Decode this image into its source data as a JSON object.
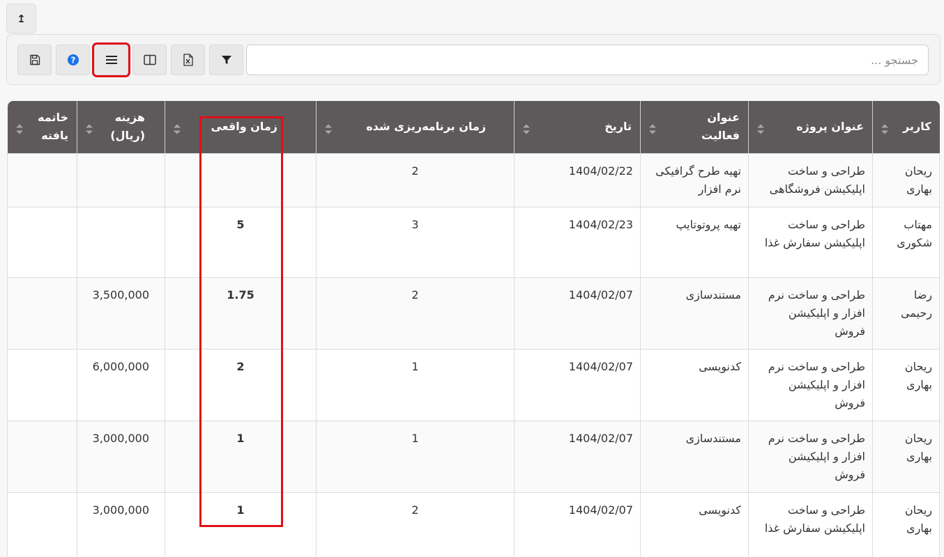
{
  "top": {
    "back_icon": "arrow-up-left-icon",
    "back_glyph": "↥"
  },
  "toolbar": {
    "search_placeholder": "جستجو ...",
    "buttons": [
      {
        "name": "save-button",
        "icon": "save-icon"
      },
      {
        "name": "help-button",
        "icon": "help-icon",
        "color": "#1a73e8"
      },
      {
        "name": "menu-button",
        "icon": "hamburger-icon"
      },
      {
        "name": "columns-button",
        "icon": "columns-icon"
      },
      {
        "name": "excel-export-button",
        "icon": "excel-icon"
      },
      {
        "name": "filter-button",
        "icon": "filter-icon"
      }
    ]
  },
  "table": {
    "headers": {
      "user": "کاربر",
      "project": "عنوان پروژه",
      "activity": "عنوان\nفعالیت",
      "date": "تاریخ",
      "planned": "زمان برنامه‌ریزی شده",
      "actual": "زمان واقعی",
      "cost": "هزینه\n(ریال)",
      "finished": "خاتمه\nیافته"
    },
    "rows": [
      {
        "user": "ریحان بهاری",
        "project": "طراحی و ساخت اپلیکیشن فروشگاهی",
        "activity": "تهیه طرح گرافیکی نرم افزار",
        "date": "1404/02/22",
        "planned": "2",
        "actual": "",
        "cost": "",
        "finished": ""
      },
      {
        "user": "مهتاب شکوری",
        "project": "طراحی و ساخت اپلیکیشن سفارش غذا",
        "activity": "تهیه پروتوتایپ",
        "date": "1404/02/23",
        "planned": "3",
        "actual": "5",
        "cost": "",
        "finished": ""
      },
      {
        "user": "رضا رحیمی",
        "project": "طراحی و ساخت نرم افزار و اپلیکیشن فروش",
        "activity": "مستندسازی",
        "date": "1404/02/07",
        "planned": "2",
        "actual": "1.75",
        "cost": "3,500,000",
        "finished": ""
      },
      {
        "user": "ریحان بهاری",
        "project": "طراحی و ساخت نرم افزار و اپلیکیشن فروش",
        "activity": "کدنویسی",
        "date": "1404/02/07",
        "planned": "1",
        "actual": "2",
        "cost": "6,000,000",
        "finished": ""
      },
      {
        "user": "ریحان بهاری",
        "project": "طراحی و ساخت نرم افزار و اپلیکیشن فروش",
        "activity": "مستندسازی",
        "date": "1404/02/07",
        "planned": "1",
        "actual": "1",
        "cost": "3,000,000",
        "finished": ""
      },
      {
        "user": "ریحان بهاری",
        "project": "طراحی و ساخت اپلیکیشن سفارش غذا",
        "activity": "کدنویسی",
        "date": "1404/02/07",
        "planned": "2",
        "actual": "1",
        "cost": "3,000,000",
        "finished": ""
      }
    ]
  },
  "colors": {
    "header_bg": "#5e5a5b",
    "highlight": "#e10f17",
    "help_blue": "#1a73e8"
  }
}
